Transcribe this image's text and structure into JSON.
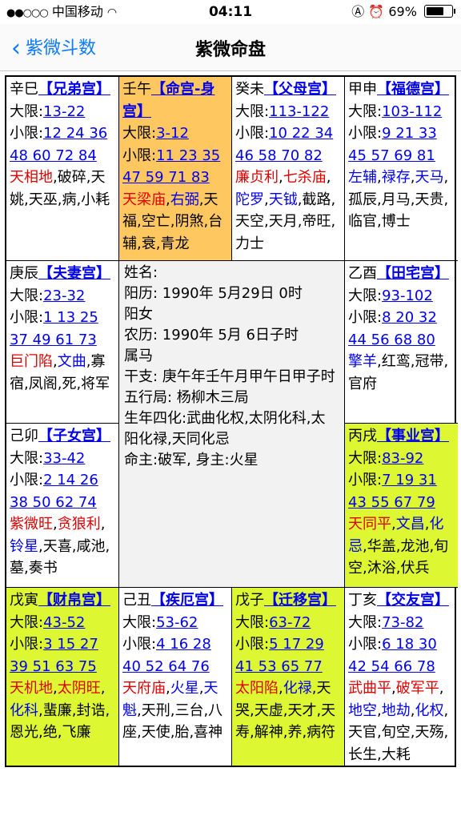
{
  "status": {
    "carrier": "中国移动",
    "time": "04:11",
    "battery": "69%",
    "battery_level": 0.69
  },
  "nav": {
    "back_label": "紫微斗数",
    "title": "紫微命盘"
  },
  "cells": [
    {
      "gz": "辛巳",
      "gong": "【兄弟宫】",
      "daxian_label": "大限:",
      "daxian": "13-22",
      "xiaoxian_label": "小限:",
      "xiaoxian": "12 24 36 48 60 72 84",
      "stars": [
        {
          "t": "天相地",
          "c": "red"
        },
        {
          "t": ",",
          "c": ""
        },
        {
          "t": "破碎,天姚,天巫,病,小耗",
          "c": ""
        }
      ]
    },
    {
      "gz": "壬午",
      "gong": "【命宫-身宫】",
      "daxian_label": "大限:",
      "daxian": "3-12",
      "xiaoxian_label": "小限:",
      "xiaoxian": "11 23 35 47 59 71 83",
      "stars": [
        {
          "t": "天梁庙",
          "c": "red"
        },
        {
          "t": ",",
          "c": ""
        },
        {
          "t": "右弼",
          "c": "blue"
        },
        {
          "t": ",天福,空亡,阴煞,台辅,衰,青龙",
          "c": ""
        }
      ]
    },
    {
      "gz": "癸未",
      "gong": "【父母宫】",
      "daxian_label": "大限:",
      "daxian": "113-122",
      "xiaoxian_label": "小限:",
      "xiaoxian": "10 22 34 46 58 70 82",
      "stars": [
        {
          "t": "廉贞利",
          "c": "red"
        },
        {
          "t": ",",
          "c": ""
        },
        {
          "t": "七杀庙",
          "c": "red"
        },
        {
          "t": ",",
          "c": ""
        },
        {
          "t": "陀罗",
          "c": "blue"
        },
        {
          "t": ",",
          "c": ""
        },
        {
          "t": "天钺",
          "c": "blue"
        },
        {
          "t": ",截路,天空,天月,帝旺,力士",
          "c": ""
        }
      ]
    },
    {
      "gz": "甲申",
      "gong": "【福德宫】",
      "daxian_label": "大限:",
      "daxian": "103-112",
      "xiaoxian_label": "小限:",
      "xiaoxian": "9 21 33 45 57 69 81",
      "stars": [
        {
          "t": "左辅",
          "c": "blue"
        },
        {
          "t": ",",
          "c": ""
        },
        {
          "t": "禄存",
          "c": "blue"
        },
        {
          "t": ",",
          "c": ""
        },
        {
          "t": "天马",
          "c": "blue"
        },
        {
          "t": ",孤辰,月马,天贵,临官,博士",
          "c": ""
        }
      ]
    },
    {
      "gz": "庚辰",
      "gong": "【夫妻宫】",
      "daxian_label": "大限:",
      "daxian": "23-32",
      "xiaoxian_label": "小限:",
      "xiaoxian": "1 13 25 37 49 61 73",
      "stars": [
        {
          "t": "巨门陷",
          "c": "red"
        },
        {
          "t": ",",
          "c": ""
        },
        {
          "t": "文曲",
          "c": "blue"
        },
        {
          "t": ",寡宿,凤阁,死,将军",
          "c": ""
        }
      ]
    },
    {
      "gz": "乙酉",
      "gong": "【田宅宫】",
      "daxian_label": "大限:",
      "daxian": "93-102",
      "xiaoxian_label": "小限:",
      "xiaoxian": "8 20 32 44 56 68 80",
      "stars": [
        {
          "t": "擎羊",
          "c": "blue"
        },
        {
          "t": ",红鸾,冠带,官府",
          "c": ""
        }
      ]
    },
    {
      "gz": "己卯",
      "gong": "【子女宫】",
      "daxian_label": "大限:",
      "daxian": "33-42",
      "xiaoxian_label": "小限:",
      "xiaoxian": "2 14 26 38 50 62 74",
      "stars": [
        {
          "t": "紫微旺",
          "c": "red"
        },
        {
          "t": ",",
          "c": ""
        },
        {
          "t": "贪狼利",
          "c": "red"
        },
        {
          "t": ",",
          "c": ""
        },
        {
          "t": "铃星",
          "c": "blue"
        },
        {
          "t": ",天喜,咸池,墓,奏书",
          "c": ""
        }
      ]
    },
    {
      "gz": "丙戌",
      "gong": "【事业宫】",
      "daxian_label": "大限:",
      "daxian": "83-92",
      "xiaoxian_label": "小限:",
      "xiaoxian": "7 19 31 43 55 67 79",
      "stars": [
        {
          "t": "天同平",
          "c": "red"
        },
        {
          "t": ",",
          "c": ""
        },
        {
          "t": "文昌",
          "c": "blue"
        },
        {
          "t": ",",
          "c": ""
        },
        {
          "t": "化忌",
          "c": "blue"
        },
        {
          "t": ",华盖,龙池,旬空,沐浴,伏兵",
          "c": ""
        }
      ]
    },
    {
      "gz": "戊寅",
      "gong": "【财帛宫】",
      "daxian_label": "大限:",
      "daxian": "43-52",
      "xiaoxian_label": "小限:",
      "xiaoxian": "3 15 27 39 51 63 75",
      "stars": [
        {
          "t": "天机地",
          "c": "red"
        },
        {
          "t": ",",
          "c": ""
        },
        {
          "t": "太阴旺",
          "c": "red"
        },
        {
          "t": ",",
          "c": ""
        },
        {
          "t": "化科",
          "c": "blue"
        },
        {
          "t": ",蜚廉,封诰,恩光,绝,飞廉",
          "c": ""
        }
      ]
    },
    {
      "gz": "己丑",
      "gong": "【疾厄宫】",
      "daxian_label": "大限:",
      "daxian": "53-62",
      "xiaoxian_label": "小限:",
      "xiaoxian": "4 16 28 40 52 64 76",
      "stars": [
        {
          "t": "天府庙",
          "c": "red"
        },
        {
          "t": ",",
          "c": ""
        },
        {
          "t": "火星",
          "c": "blue"
        },
        {
          "t": ",",
          "c": ""
        },
        {
          "t": "天魁",
          "c": "blue"
        },
        {
          "t": ",天刑,三台,八座,天使,胎,喜神",
          "c": ""
        }
      ]
    },
    {
      "gz": "戊子",
      "gong": "【迁移宫】",
      "daxian_label": "大限:",
      "daxian": "63-72",
      "xiaoxian_label": "小限:",
      "xiaoxian": "5 17 29 41 53 65 77",
      "stars": [
        {
          "t": "太阳陷",
          "c": "red"
        },
        {
          "t": ",",
          "c": ""
        },
        {
          "t": "化禄",
          "c": "blue"
        },
        {
          "t": ",天哭,天虚,天才,天寿,解神,养,病符",
          "c": ""
        }
      ]
    },
    {
      "gz": "丁亥",
      "gong": "【交友宫】",
      "daxian_label": "大限:",
      "daxian": "73-82",
      "xiaoxian_label": "小限:",
      "xiaoxian": "6 18 30 42 54 66 78",
      "stars": [
        {
          "t": "武曲平",
          "c": "red"
        },
        {
          "t": ",",
          "c": ""
        },
        {
          "t": "破军平",
          "c": "red"
        },
        {
          "t": ",",
          "c": ""
        },
        {
          "t": "地空",
          "c": "blue"
        },
        {
          "t": ",",
          "c": ""
        },
        {
          "t": "地劫",
          "c": "blue"
        },
        {
          "t": ",",
          "c": ""
        },
        {
          "t": "化权",
          "c": "blue"
        },
        {
          "t": ",天官,旬空,天殇,长生,大耗",
          "c": ""
        }
      ]
    }
  ],
  "center": {
    "lines": [
      "姓名:",
      "阳历:  1990年 5月29日 0时",
      "阳女",
      "农历:  1990年 5月 6日子时",
      "属马",
      "干支:  庚午年壬午月甲午日甲子时",
      "五行局: 杨柳木三局",
      "生年四化:武曲化权,太阴化科,太阳化禄,天同化忌",
      "命主:破军, 身主:火星"
    ]
  }
}
